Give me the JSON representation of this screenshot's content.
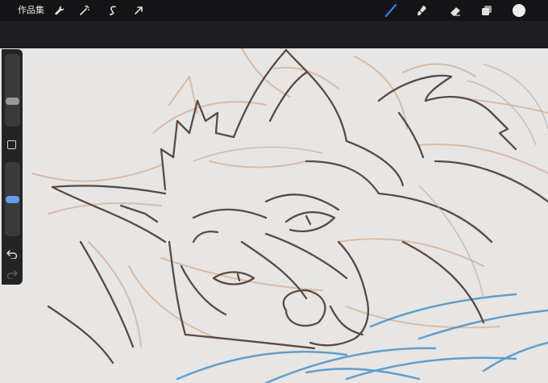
{
  "toolbar": {
    "gallery_label": "作品集",
    "left_tools": [
      "wrench-icon",
      "magic-wand-icon",
      "selection-icon",
      "transform-arrow-icon"
    ],
    "right_tools": [
      "brush-icon",
      "smudge-icon",
      "eraser-icon",
      "layers-icon",
      "color-swatch"
    ],
    "active_tool": "brush-icon",
    "brush_color": "#2f7ff0",
    "current_color": "#eeeeee"
  },
  "sidebar": {
    "brush_size_level": 0.33,
    "opacity_level": 0.5,
    "accent_color": "#6b9cf0"
  },
  "canvas": {
    "background_color": "#e7e6e5",
    "layers": {
      "sketch_color": "#dcb79c",
      "lineart_color": "#5a4a42",
      "blanket_color": "#4a92c8"
    }
  }
}
